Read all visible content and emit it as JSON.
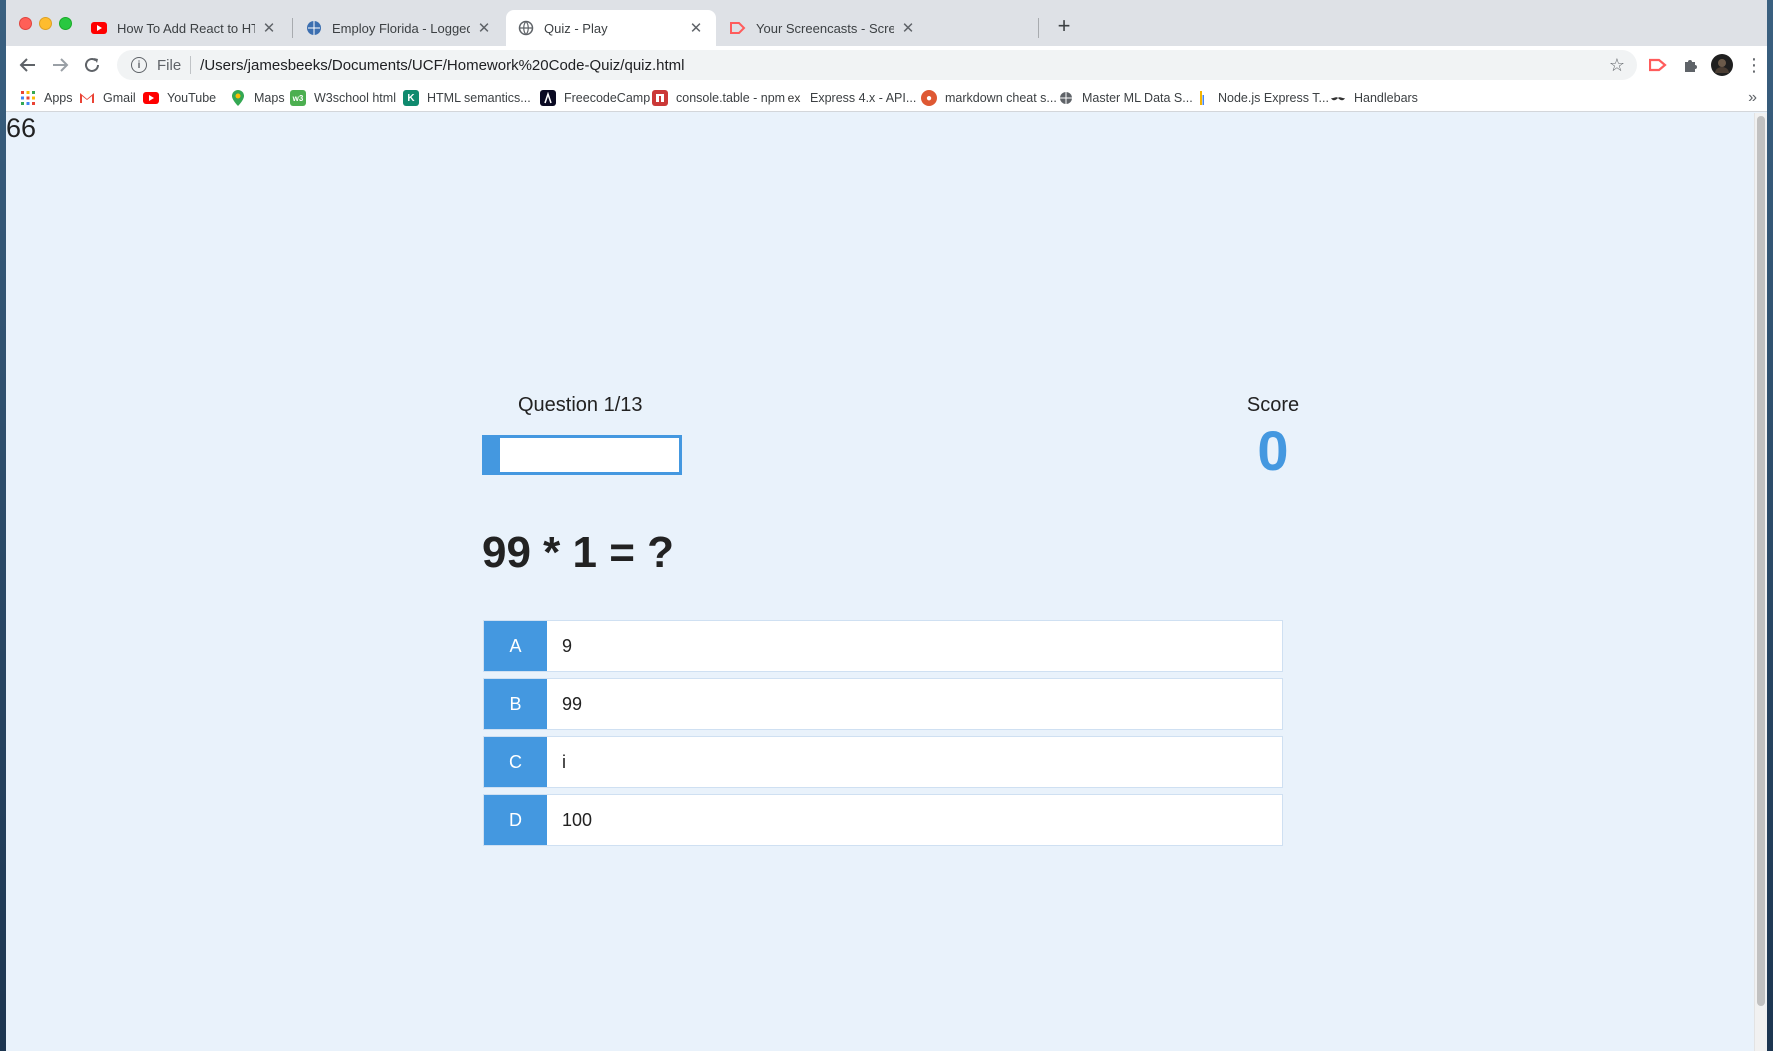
{
  "browser": {
    "tabs": [
      {
        "title": "How To Add React to HTML We",
        "favicon": "youtube-icon",
        "active": false
      },
      {
        "title": "Employ Florida - Logged Off",
        "favicon": "globe-icon",
        "active": false
      },
      {
        "title": "Quiz - Play",
        "favicon": "globe-icon",
        "active": true
      },
      {
        "title": "Your Screencasts - Screencast",
        "favicon": "screencastify-icon",
        "active": false
      }
    ],
    "new_tab_label": "+",
    "omnibox": {
      "scheme": "File",
      "url": "/Users/jamesbeeks/Documents/UCF/Homework%20Code-Quiz/quiz.html"
    },
    "bookmarks": [
      {
        "label": "Apps",
        "icon": "apps-grid-icon"
      },
      {
        "label": "Gmail",
        "icon": "gmail-icon"
      },
      {
        "label": "YouTube",
        "icon": "youtube-icon"
      },
      {
        "label": "Maps",
        "icon": "maps-icon"
      },
      {
        "label": "W3school html",
        "icon": "w3schools-icon"
      },
      {
        "label": "HTML semantics...",
        "icon": "html-icon"
      },
      {
        "label": "FreecodeCamp",
        "icon": "freecodecamp-icon"
      },
      {
        "label": "console.table - npm",
        "icon": "npm-icon"
      },
      {
        "label": "Express 4.x - API...",
        "icon": "express-icon"
      },
      {
        "label": "markdown cheat s...",
        "icon": "duckduckgo-icon"
      },
      {
        "label": "Master ML Data S...",
        "icon": "globe-icon"
      },
      {
        "label": "Node.js Express T...",
        "icon": "bar-icon"
      },
      {
        "label": "Handlebars",
        "icon": "mustache-icon"
      }
    ],
    "bookmarks_overflow": "»"
  },
  "page": {
    "timer": "66",
    "hud": {
      "question_label": "Question 1/13",
      "progress_fraction": 0.077,
      "score_label": "Score",
      "score_value": "0"
    },
    "question": "99 * 1 = ?",
    "choices": [
      {
        "prefix": "A",
        "text": "9"
      },
      {
        "prefix": "B",
        "text": "99"
      },
      {
        "prefix": "C",
        "text": "i"
      },
      {
        "prefix": "D",
        "text": "100"
      }
    ]
  },
  "colors": {
    "accent": "#4498e0",
    "page_background": "#e9f2fb",
    "tabstrip": "#dee1e6"
  }
}
